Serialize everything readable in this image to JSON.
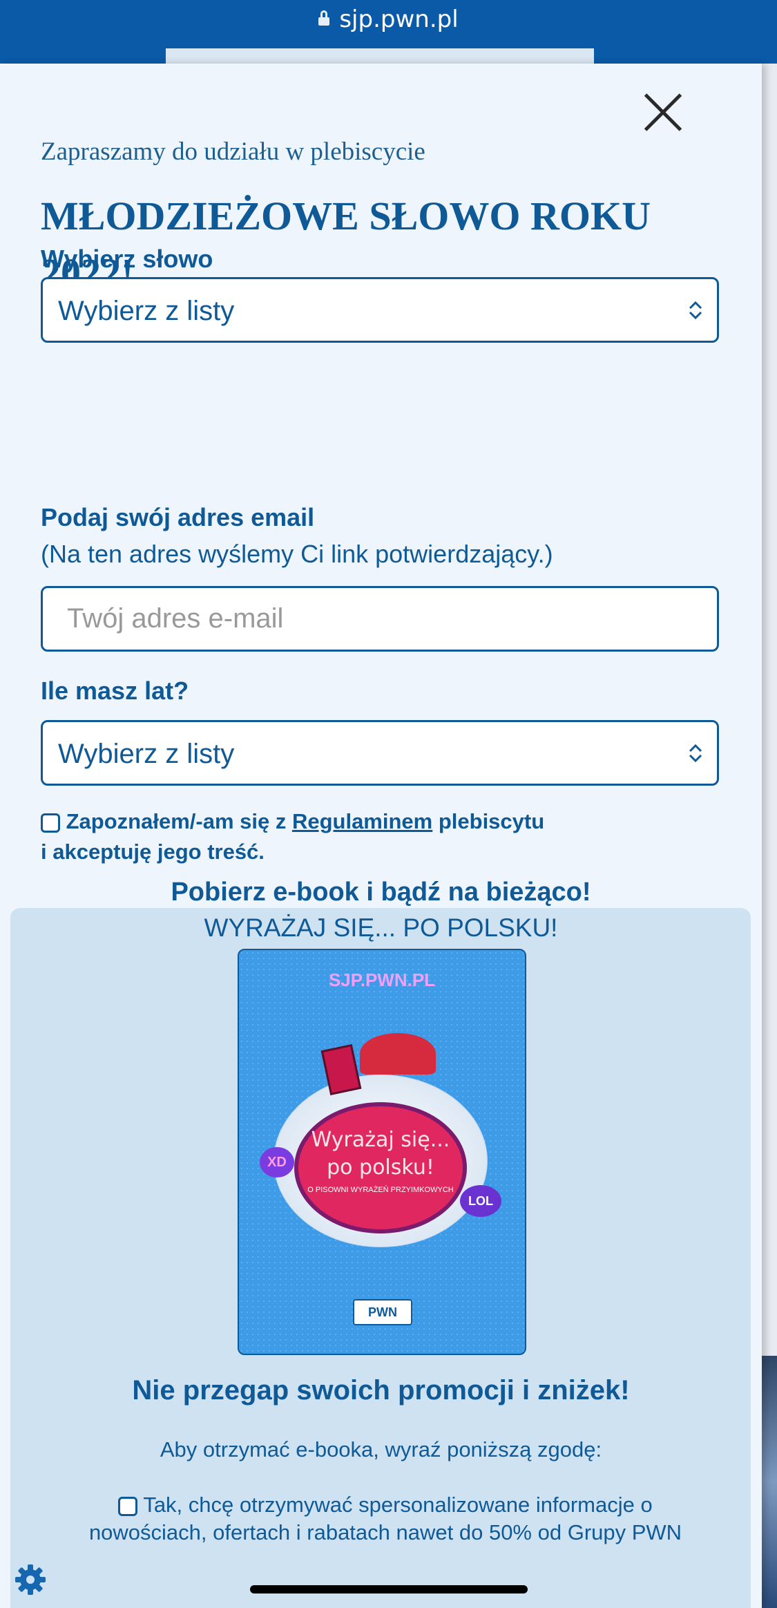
{
  "browser": {
    "url": "sjp.pwn.pl"
  },
  "modal": {
    "invite": "Zapraszamy do udziału w plebiscycie",
    "title": "MŁODZIEŻOWE SŁOWO ROKU 2022!",
    "word_label": "Wybierz słowo",
    "word_select_value": "Wybierz z listy",
    "email_label": "Podaj swój adres email",
    "email_note": "(Na ten adres wyślemy Ci link potwierdzający.)",
    "email_placeholder": "Twój adres e-mail",
    "age_label": "Ile masz lat?",
    "age_select_value": "Wybierz z listy",
    "terms_prefix": "Zapoznałem/-am się z ",
    "terms_link": "Regulaminem",
    "terms_suffix": " plebiscytu",
    "terms_line2": "i akceptuję jego treść."
  },
  "promo": {
    "title": "Pobierz e-book i bądź na bieżąco!",
    "subtitle": "WYRAŻAJ SIĘ... PO POLSKU!",
    "cover": {
      "brand": "SJP.PWN.PL",
      "book_title_1": "Wyrażaj się...",
      "book_title_2": "po polsku!",
      "book_sub": "O PISOWNI WYRAŻEŃ PRZYIMKOWYCH",
      "sticker_xd": "XD",
      "sticker_lol": "LOL",
      "publisher": "PWN"
    },
    "headline": "Nie przegap swoich promocji i zniżek!",
    "consent_intro": "Aby otrzymać e-booka, wyraź poniższą zgodę:",
    "marketing_line1": "Tak, chcę otrzymywać spersonalizowane informacje o",
    "marketing_line2": "nowościach, ofertach i rabatach nawet do 50% od Grupy PWN"
  },
  "icons": {
    "lock": "lock-icon",
    "close": "close-icon",
    "chevron": "chevron-up-down-icon",
    "settings": "gear-icon"
  },
  "colors": {
    "brand_blue": "#0f5a96",
    "header_blue": "#0a5aa8",
    "modal_bg": "#eef5fc",
    "promo_bg": "#cee2f2"
  }
}
